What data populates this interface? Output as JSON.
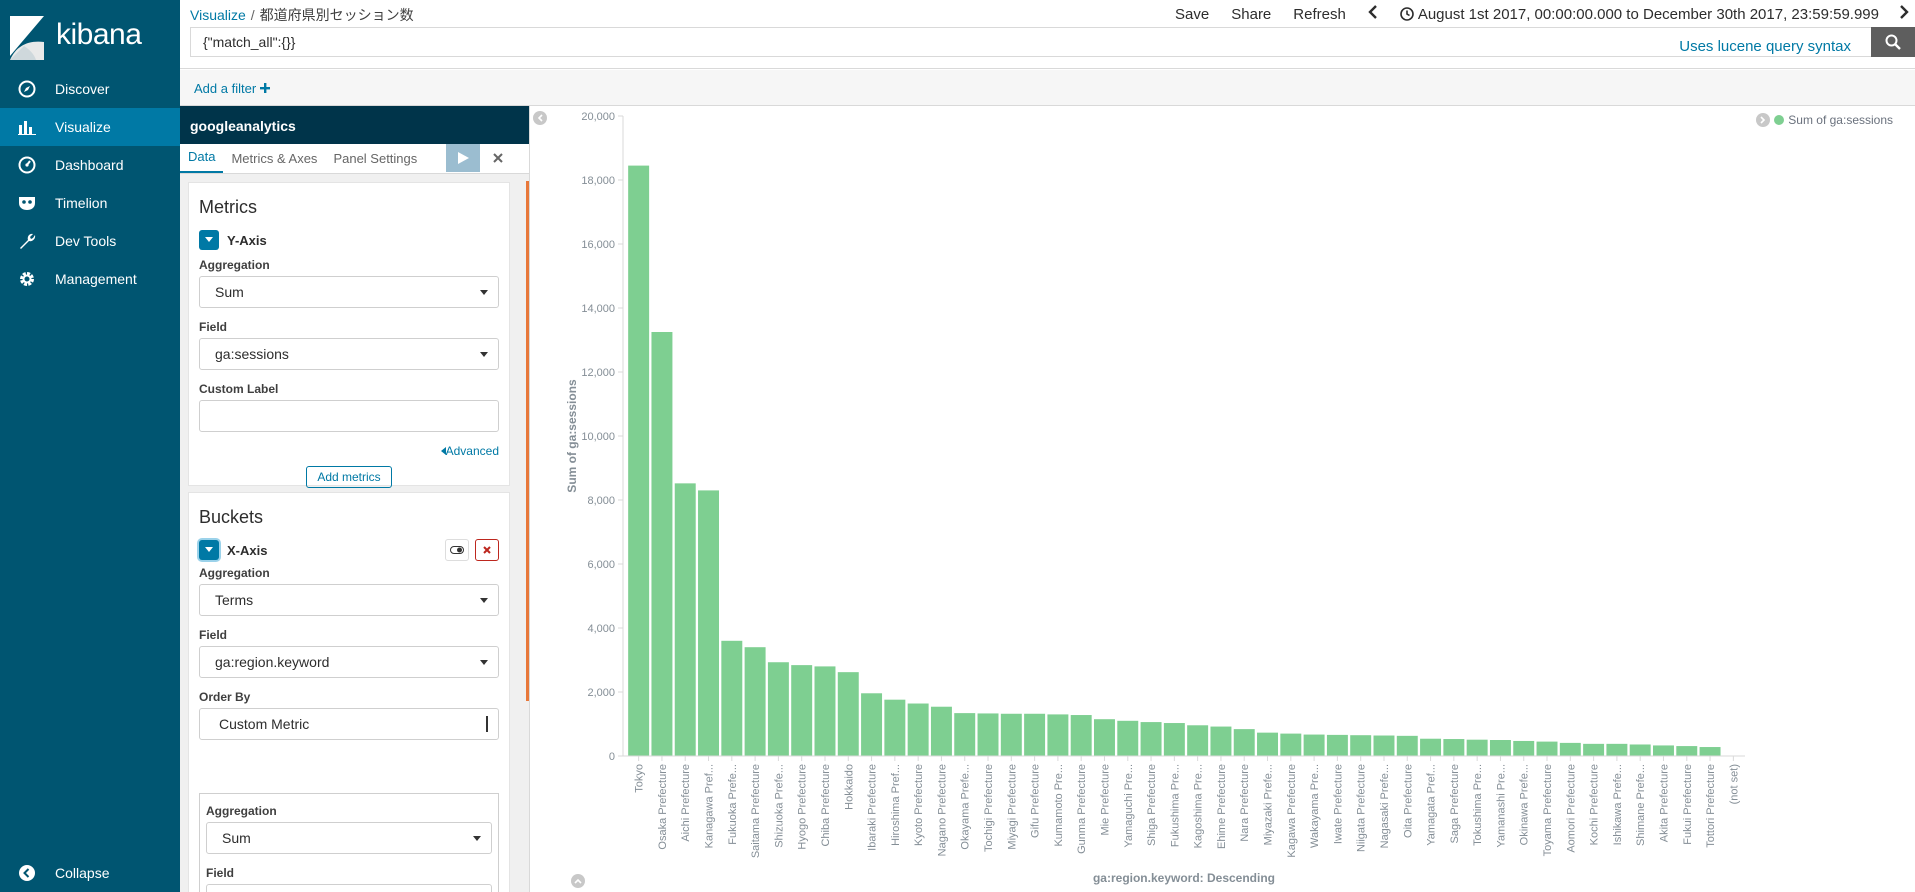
{
  "app": {
    "name": "kibana"
  },
  "sidebar": {
    "items": [
      {
        "label": "Discover",
        "icon": "compass-icon"
      },
      {
        "label": "Visualize",
        "icon": "bar-chart-icon"
      },
      {
        "label": "Dashboard",
        "icon": "gauge-icon"
      },
      {
        "label": "Timelion",
        "icon": "mask-icon"
      },
      {
        "label": "Dev Tools",
        "icon": "wrench-icon"
      },
      {
        "label": "Management",
        "icon": "gear-icon"
      }
    ],
    "active": "Visualize",
    "collapse_label": "Collapse"
  },
  "header": {
    "breadcrumb_root": "Visualize",
    "breadcrumb_sep": "/",
    "breadcrumb_current": "都道府県別セッション数",
    "save_label": "Save",
    "share_label": "Share",
    "refresh_label": "Refresh",
    "time_range": "August 1st 2017, 00:00:00.000 to December 30th 2017, 23:59:59.999"
  },
  "query": {
    "value": "{\"match_all\":{}}",
    "syntax_link": "Uses lucene query syntax"
  },
  "filter": {
    "add_label": "Add a filter"
  },
  "editor": {
    "index_title": "googleanalytics",
    "tabs": [
      "Data",
      "Metrics & Axes",
      "Panel Settings"
    ],
    "active_tab": "Data",
    "metrics": {
      "heading": "Metrics",
      "agg_title": "Y-Axis",
      "aggregation_label": "Aggregation",
      "aggregation_value": "Sum",
      "field_label": "Field",
      "field_value": "ga:sessions",
      "custom_label_label": "Custom Label",
      "custom_label_value": "",
      "advanced_label": "Advanced",
      "add_metrics_label": "Add metrics"
    },
    "buckets": {
      "heading": "Buckets",
      "agg_title": "X-Axis",
      "aggregation_label": "Aggregation",
      "aggregation_value": "Terms",
      "field_label": "Field",
      "field_value": "ga:region.keyword",
      "order_by_label": "Order By",
      "order_by_value": "Custom Metric",
      "sub_aggregation_label": "Aggregation",
      "sub_aggregation_value": "Sum",
      "sub_field_label": "Field"
    }
  },
  "colors": {
    "bar": "#7ecf91",
    "sidebar": "#005571",
    "active": "#0079a5",
    "accent": "#0079a5"
  },
  "chart_data": {
    "type": "bar",
    "ylabel": "Sum of ga:sessions",
    "xlabel": "ga:region.keyword: Descending",
    "legend": "Sum of ga:sessions",
    "legend_position": "top-right",
    "ylim": [
      0,
      20000
    ],
    "yticks": [
      0,
      2000,
      4000,
      6000,
      8000,
      10000,
      12000,
      14000,
      16000,
      18000,
      20000
    ],
    "ytick_labels": [
      "0",
      "2,000",
      "4,000",
      "6,000",
      "8,000",
      "10,000",
      "12,000",
      "14,000",
      "16,000",
      "18,000",
      "20,000"
    ],
    "categories": [
      "Tokyo",
      "Osaka Prefecture",
      "Aichi Prefecture",
      "Kanagawa Pref...",
      "Fukuoka Prefe...",
      "Saitama Prefecture",
      "Shizuoka Prefe...",
      "Hyogo Prefecture",
      "Chiba Prefecture",
      "Hokkaido",
      "Ibaraki Prefecture",
      "Hiroshima Pref...",
      "Kyoto Prefecture",
      "Nagano Prefecture",
      "Okayama Prefe...",
      "Tochigi Prefecture",
      "Miyagi Prefecture",
      "Gifu Prefecture",
      "Kumamoto Pre...",
      "Gunma Prefecture",
      "Mie Prefecture",
      "Yamaguchi Pre...",
      "Shiga Prefecture",
      "Fukushima Pre...",
      "Kagoshima Pre...",
      "Ehime Prefecture",
      "Nara Prefecture",
      "Miyazaki Prefe...",
      "Kagawa Prefecture",
      "Wakayama Pre...",
      "Iwate Prefecture",
      "Niigata Prefecture",
      "Nagasaki Prefe...",
      "Oita Prefecture",
      "Yamagata Pref...",
      "Saga Prefecture",
      "Tokushima Pre...",
      "Yamanashi Pre...",
      "Okinawa Prefe...",
      "Toyama Prefecture",
      "Aomori Prefecture",
      "Kochi Prefecture",
      "Ishikawa Prefe...",
      "Shimane Prefe...",
      "Akita Prefecture",
      "Fukui Prefecture",
      "Tottori Prefecture",
      "(not set)"
    ],
    "values": [
      18450,
      13250,
      8520,
      8300,
      3600,
      3400,
      2930,
      2840,
      2800,
      2620,
      1960,
      1760,
      1640,
      1540,
      1340,
      1330,
      1320,
      1320,
      1300,
      1280,
      1150,
      1100,
      1060,
      1030,
      960,
      920,
      840,
      730,
      700,
      670,
      660,
      650,
      640,
      630,
      540,
      530,
      510,
      500,
      470,
      450,
      410,
      380,
      380,
      360,
      330,
      310,
      280,
      0
    ],
    "grid": false
  }
}
